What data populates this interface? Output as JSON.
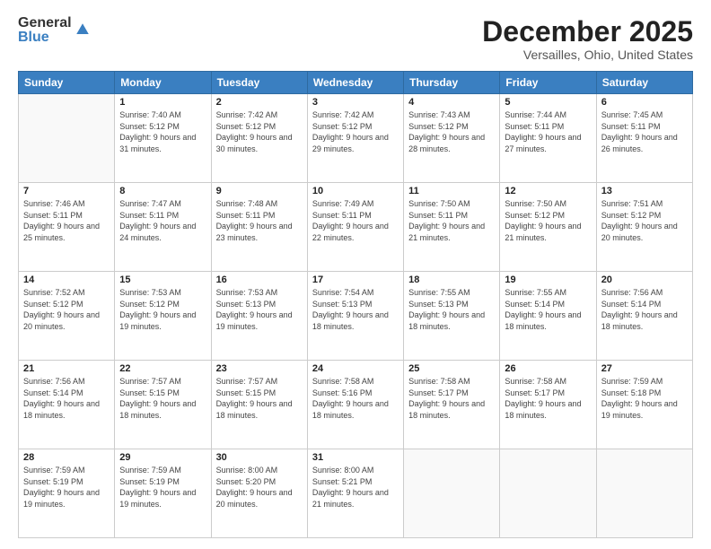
{
  "logo": {
    "general": "General",
    "blue": "Blue"
  },
  "title": "December 2025",
  "location": "Versailles, Ohio, United States",
  "days_of_week": [
    "Sunday",
    "Monday",
    "Tuesday",
    "Wednesday",
    "Thursday",
    "Friday",
    "Saturday"
  ],
  "weeks": [
    [
      {
        "day": "",
        "info": ""
      },
      {
        "day": "1",
        "info": "Sunrise: 7:40 AM\nSunset: 5:12 PM\nDaylight: 9 hours and 31 minutes."
      },
      {
        "day": "2",
        "info": "Sunrise: 7:42 AM\nSunset: 5:12 PM\nDaylight: 9 hours and 30 minutes."
      },
      {
        "day": "3",
        "info": "Sunrise: 7:42 AM\nSunset: 5:12 PM\nDaylight: 9 hours and 29 minutes."
      },
      {
        "day": "4",
        "info": "Sunrise: 7:43 AM\nSunset: 5:12 PM\nDaylight: 9 hours and 28 minutes."
      },
      {
        "day": "5",
        "info": "Sunrise: 7:44 AM\nSunset: 5:11 PM\nDaylight: 9 hours and 27 minutes."
      },
      {
        "day": "6",
        "info": "Sunrise: 7:45 AM\nSunset: 5:11 PM\nDaylight: 9 hours and 26 minutes."
      }
    ],
    [
      {
        "day": "7",
        "info": "Sunrise: 7:46 AM\nSunset: 5:11 PM\nDaylight: 9 hours and 25 minutes."
      },
      {
        "day": "8",
        "info": "Sunrise: 7:47 AM\nSunset: 5:11 PM\nDaylight: 9 hours and 24 minutes."
      },
      {
        "day": "9",
        "info": "Sunrise: 7:48 AM\nSunset: 5:11 PM\nDaylight: 9 hours and 23 minutes."
      },
      {
        "day": "10",
        "info": "Sunrise: 7:49 AM\nSunset: 5:11 PM\nDaylight: 9 hours and 22 minutes."
      },
      {
        "day": "11",
        "info": "Sunrise: 7:50 AM\nSunset: 5:11 PM\nDaylight: 9 hours and 21 minutes."
      },
      {
        "day": "12",
        "info": "Sunrise: 7:50 AM\nSunset: 5:12 PM\nDaylight: 9 hours and 21 minutes."
      },
      {
        "day": "13",
        "info": "Sunrise: 7:51 AM\nSunset: 5:12 PM\nDaylight: 9 hours and 20 minutes."
      }
    ],
    [
      {
        "day": "14",
        "info": "Sunrise: 7:52 AM\nSunset: 5:12 PM\nDaylight: 9 hours and 20 minutes."
      },
      {
        "day": "15",
        "info": "Sunrise: 7:53 AM\nSunset: 5:12 PM\nDaylight: 9 hours and 19 minutes."
      },
      {
        "day": "16",
        "info": "Sunrise: 7:53 AM\nSunset: 5:13 PM\nDaylight: 9 hours and 19 minutes."
      },
      {
        "day": "17",
        "info": "Sunrise: 7:54 AM\nSunset: 5:13 PM\nDaylight: 9 hours and 18 minutes."
      },
      {
        "day": "18",
        "info": "Sunrise: 7:55 AM\nSunset: 5:13 PM\nDaylight: 9 hours and 18 minutes."
      },
      {
        "day": "19",
        "info": "Sunrise: 7:55 AM\nSunset: 5:14 PM\nDaylight: 9 hours and 18 minutes."
      },
      {
        "day": "20",
        "info": "Sunrise: 7:56 AM\nSunset: 5:14 PM\nDaylight: 9 hours and 18 minutes."
      }
    ],
    [
      {
        "day": "21",
        "info": "Sunrise: 7:56 AM\nSunset: 5:14 PM\nDaylight: 9 hours and 18 minutes."
      },
      {
        "day": "22",
        "info": "Sunrise: 7:57 AM\nSunset: 5:15 PM\nDaylight: 9 hours and 18 minutes."
      },
      {
        "day": "23",
        "info": "Sunrise: 7:57 AM\nSunset: 5:15 PM\nDaylight: 9 hours and 18 minutes."
      },
      {
        "day": "24",
        "info": "Sunrise: 7:58 AM\nSunset: 5:16 PM\nDaylight: 9 hours and 18 minutes."
      },
      {
        "day": "25",
        "info": "Sunrise: 7:58 AM\nSunset: 5:17 PM\nDaylight: 9 hours and 18 minutes."
      },
      {
        "day": "26",
        "info": "Sunrise: 7:58 AM\nSunset: 5:17 PM\nDaylight: 9 hours and 18 minutes."
      },
      {
        "day": "27",
        "info": "Sunrise: 7:59 AM\nSunset: 5:18 PM\nDaylight: 9 hours and 19 minutes."
      }
    ],
    [
      {
        "day": "28",
        "info": "Sunrise: 7:59 AM\nSunset: 5:19 PM\nDaylight: 9 hours and 19 minutes."
      },
      {
        "day": "29",
        "info": "Sunrise: 7:59 AM\nSunset: 5:19 PM\nDaylight: 9 hours and 19 minutes."
      },
      {
        "day": "30",
        "info": "Sunrise: 8:00 AM\nSunset: 5:20 PM\nDaylight: 9 hours and 20 minutes."
      },
      {
        "day": "31",
        "info": "Sunrise: 8:00 AM\nSunset: 5:21 PM\nDaylight: 9 hours and 21 minutes."
      },
      {
        "day": "",
        "info": ""
      },
      {
        "day": "",
        "info": ""
      },
      {
        "day": "",
        "info": ""
      }
    ]
  ]
}
